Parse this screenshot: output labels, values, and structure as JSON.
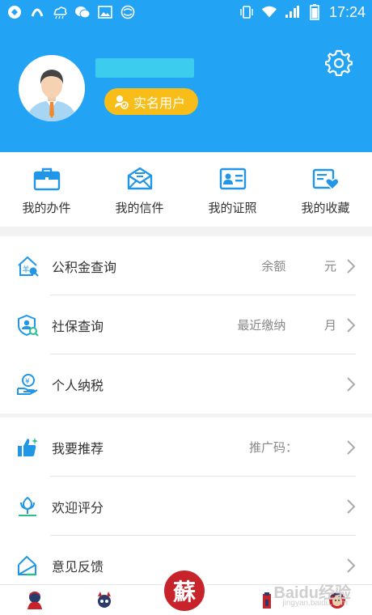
{
  "status_bar": {
    "time": "17:24"
  },
  "header": {
    "badge_label": "实名用户"
  },
  "quick_actions": [
    {
      "label": "我的办件",
      "icon": "briefcase-icon"
    },
    {
      "label": "我的信件",
      "icon": "mail-icon"
    },
    {
      "label": "我的证照",
      "icon": "id-card-icon"
    },
    {
      "label": "我的收藏",
      "icon": "favorites-icon"
    }
  ],
  "group1": [
    {
      "label": "公积金查询",
      "value": "余额          元",
      "icon": "housing-fund-icon"
    },
    {
      "label": "社保查询",
      "value": "最近缴纳          月",
      "icon": "social-security-icon"
    },
    {
      "label": "个人纳税",
      "value": "",
      "icon": "tax-icon"
    }
  ],
  "group2": [
    {
      "label": "我要推荐",
      "value": "推广码：",
      "icon": "recommend-icon"
    },
    {
      "label": "欢迎评分",
      "value": "",
      "icon": "rate-icon"
    },
    {
      "label": "意见反馈",
      "value": "",
      "icon": "feedback-icon"
    }
  ],
  "tabbar": {
    "center_glyph": "蘇"
  },
  "watermark": {
    "text": "Baidu经验",
    "sub": "jingyan.baidu.com"
  },
  "colors": {
    "primary": "#23a3f3",
    "badge": "#f8bd18",
    "icon_blue": "#2196e6"
  }
}
